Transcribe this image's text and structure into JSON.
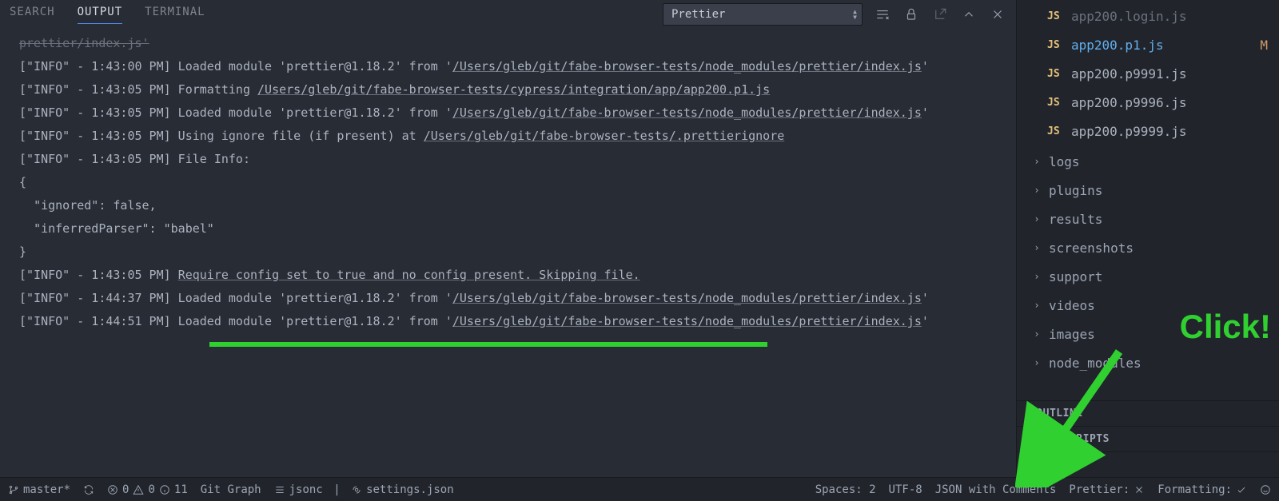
{
  "tabs": {
    "search": "SEARCH",
    "output": "OUTPUT",
    "terminal": "TERMINAL"
  },
  "channel": "Prettier",
  "output_lines": [
    {
      "type": "cut",
      "text": "prettier/index.js'"
    },
    {
      "type": "plain",
      "prefix": "[\"INFO\" - 1:43:00 PM] Loaded module 'prettier@1.18.2' from '",
      "path": "/Users/gleb/git/fabe-browser-tests/node_modules/prettier/index.js",
      "suffix": "'"
    },
    {
      "type": "plain",
      "prefix": "[\"INFO\" - 1:43:05 PM] Formatting ",
      "path": "/Users/gleb/git/fabe-browser-tests/cypress/integration/app/app200.p1.js",
      "suffix": ""
    },
    {
      "type": "plain",
      "prefix": "[\"INFO\" - 1:43:05 PM] Loaded module 'prettier@1.18.2' from '",
      "path": "/Users/gleb/git/fabe-browser-tests/node_modules/prettier/index.js",
      "suffix": "'"
    },
    {
      "type": "plain",
      "prefix": "[\"INFO\" - 1:43:05 PM] Using ignore file (if present) at ",
      "path": "/Users/gleb/git/fabe-browser-tests/.prettierignore",
      "suffix": ""
    },
    {
      "type": "raw",
      "text": "[\"INFO\" - 1:43:05 PM] File Info:"
    },
    {
      "type": "raw",
      "text": "{"
    },
    {
      "type": "raw",
      "text": "  \"ignored\": false,"
    },
    {
      "type": "raw",
      "text": "  \"inferredParser\": \"babel\""
    },
    {
      "type": "raw",
      "text": "}"
    },
    {
      "type": "highlight",
      "prefix": "[\"INFO\" - 1:43:05 PM] ",
      "path": "Require config set to true and no config present. Skipping file.",
      "suffix": ""
    },
    {
      "type": "plain",
      "prefix": "[\"INFO\" - 1:44:37 PM] Loaded module 'prettier@1.18.2' from '",
      "path": "/Users/gleb/git/fabe-browser-tests/node_modules/prettier/index.js",
      "suffix": "'"
    },
    {
      "type": "plain",
      "prefix": "[\"INFO\" - 1:44:51 PM] Loaded module 'prettier@1.18.2' from '",
      "path": "/Users/gleb/git/fabe-browser-tests/node_modules/prettier/index.js",
      "suffix": "'"
    }
  ],
  "sidebar": {
    "files": [
      {
        "name": "app200.login.js",
        "cut": true
      },
      {
        "name": "app200.p1.js",
        "active": true,
        "mod": "M"
      },
      {
        "name": "app200.p9991.js"
      },
      {
        "name": "app200.p9996.js"
      },
      {
        "name": "app200.p9999.js"
      }
    ],
    "folders": [
      "logs",
      "plugins",
      "results",
      "screenshots",
      "support",
      "videos",
      "images",
      "node_modules"
    ],
    "sections": [
      "OUTLINE",
      "NPM SCRIPTS",
      "T"
    ]
  },
  "statusbar": {
    "branch": "master*",
    "errors": "0",
    "warnings": "0",
    "info": "11",
    "gitgraph": "Git Graph",
    "jsonc": "jsonc",
    "settings": "settings.json",
    "spaces": "Spaces: 2",
    "encoding": "UTF-8",
    "lang": "JSON with Comments",
    "prettier": "Prettier:",
    "formatting": "Formatting:"
  },
  "annotation": "Click!"
}
